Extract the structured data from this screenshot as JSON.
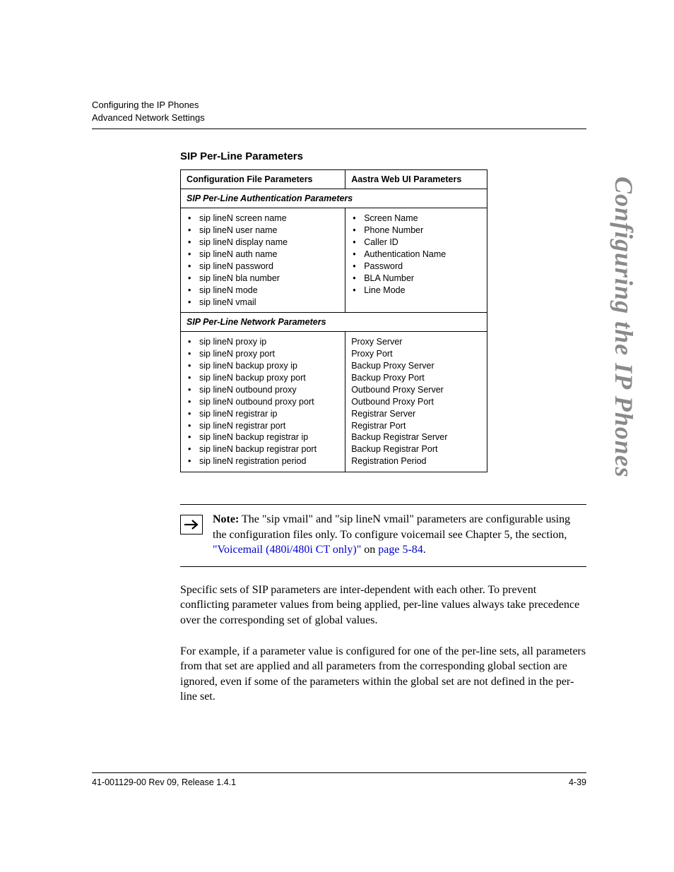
{
  "header": {
    "line1": "Configuring the IP Phones",
    "line2": "Advanced Network Settings"
  },
  "side_title": "Configuring the IP Phones",
  "section_title": "SIP Per-Line Parameters",
  "table": {
    "col1_header": "Configuration File Parameters",
    "col2_header": "Aastra Web UI Parameters",
    "sub1": "SIP Per-Line Authentication Parameters",
    "auth_config": [
      "sip lineN screen name",
      "sip lineN user name",
      "sip lineN display name",
      "sip lineN auth name",
      "sip lineN password",
      "sip lineN bla number",
      "sip lineN mode",
      "sip lineN vmail"
    ],
    "auth_web": [
      "Screen Name",
      "Phone Number",
      "Caller ID",
      "Authentication Name",
      "Password",
      "BLA Number",
      "Line Mode"
    ],
    "sub2": "SIP Per-Line Network Parameters",
    "net_config": [
      "sip lineN proxy ip",
      "sip lineN proxy port",
      "sip lineN backup proxy ip",
      "sip lineN backup proxy port",
      "sip lineN outbound proxy",
      "sip lineN outbound proxy port",
      "sip lineN registrar ip",
      "sip lineN registrar port",
      "sip lineN backup registrar ip",
      "sip lineN backup registrar port",
      "sip lineN registration period"
    ],
    "net_web": [
      "Proxy Server",
      "Proxy Port",
      "Backup Proxy Server",
      "Backup Proxy Port",
      "Outbound Proxy Server",
      "Outbound Proxy Port",
      "Registrar Server",
      "Registrar Port",
      "Backup Registrar Server",
      "Backup Registrar Port",
      "Registration Period"
    ]
  },
  "note": {
    "label": "Note:",
    "text_a": " The \"sip vmail\" and \"sip lineN vmail\" parameters are configurable using the configuration files only. To configure voicemail see Chapter 5, the section, ",
    "link1": "\"Voicemail (480i/480i CT only)\"",
    "text_b": " on ",
    "link2": "page 5-84",
    "text_c": "."
  },
  "para1": "Specific sets of SIP parameters are inter-dependent with each other. To prevent conflicting parameter values from being applied, per-line values always take precedence over the corresponding set of global values.",
  "para2": "For example, if a parameter value is configured for one of the per-line sets, all parameters from that set are applied and all parameters from the corresponding global section are ignored, even if some of the parameters within the global set are not defined in the per-line set.",
  "footer": {
    "left": "41-001129-00 Rev 09, Release 1.4.1",
    "right": "4-39"
  }
}
